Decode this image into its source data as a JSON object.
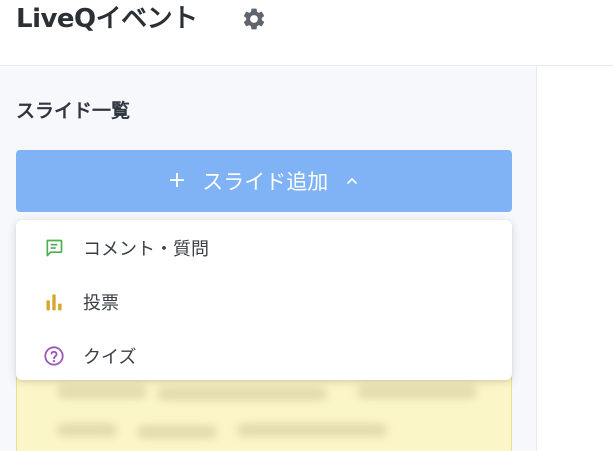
{
  "header": {
    "title": "LiveQイベント",
    "settings_icon": "gear-icon"
  },
  "sidebar": {
    "section_title": "スライド一覧",
    "add_button": {
      "plus": "+",
      "label": "スライド追加",
      "chevron_icon": "chevron-up-icon"
    },
    "menu": [
      {
        "label": "コメント・質問",
        "icon": "comment-icon",
        "color": "#4caf50"
      },
      {
        "label": "投票",
        "icon": "bar-chart-icon",
        "color": "#d4a62a"
      },
      {
        "label": "クイズ",
        "icon": "question-circle-icon",
        "color": "#9b59b6"
      }
    ]
  },
  "colors": {
    "accent": "#7fb3f5",
    "slide_card": "#fbf6c8"
  }
}
